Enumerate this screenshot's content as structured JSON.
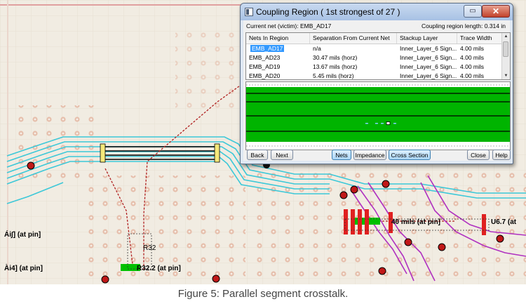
{
  "dialog": {
    "title": "Coupling Region  ( 1st strongest of 27 )",
    "restore_glyph": "▭",
    "close_glyph": "✕",
    "victim_label": "Current net (victim): EMB_AD17",
    "coupling_length": "Coupling region length: 0.314 in",
    "columns": [
      "Nets In Region",
      "Separation From Current Net",
      "Stackup Layer",
      "Trace Width"
    ],
    "rows": [
      [
        "EMB_AD17",
        "n/a",
        "Inner_Layer_6 Sign...",
        "4.00 mils"
      ],
      [
        "EMB_AD23",
        "30.47 mils (horz)",
        "Inner_Layer_6 Sign...",
        "4.00 mils"
      ],
      [
        "EMB_AD19",
        "13.67 mils (horz)",
        "Inner_Layer_6 Sign...",
        "4.00 mils"
      ],
      [
        "EMB_AD20",
        "5.45 mils (horz)",
        "Inner_Layer_6 Sign...",
        "4.00 mils"
      ]
    ],
    "buttons": {
      "back": "Back",
      "next": "Next",
      "nets": "Nets",
      "impedance": "Impedance",
      "cross_section": "Cross Section",
      "close": "Close",
      "help": "Help"
    }
  },
  "pcb": {
    "labels": {
      "left_top": "Ái∫] (at pin]",
      "left_bottom": "Ài4] (at pin]",
      "r32": "R32",
      "r32_pin": "R32.2 (at pin]",
      "mid_pin": "40 mils (at pin]",
      "u6": "U6.7 (at"
    },
    "colors": {
      "board": "#f1ece2",
      "copper_green": "#00b400",
      "trace_cyan": "#3cc8d8",
      "trace_magenta": "#b030c0",
      "trace_red": "#c02020",
      "pad": "#e8c3b0"
    }
  },
  "caption": "Figure 5: Parallel segment crosstalk."
}
